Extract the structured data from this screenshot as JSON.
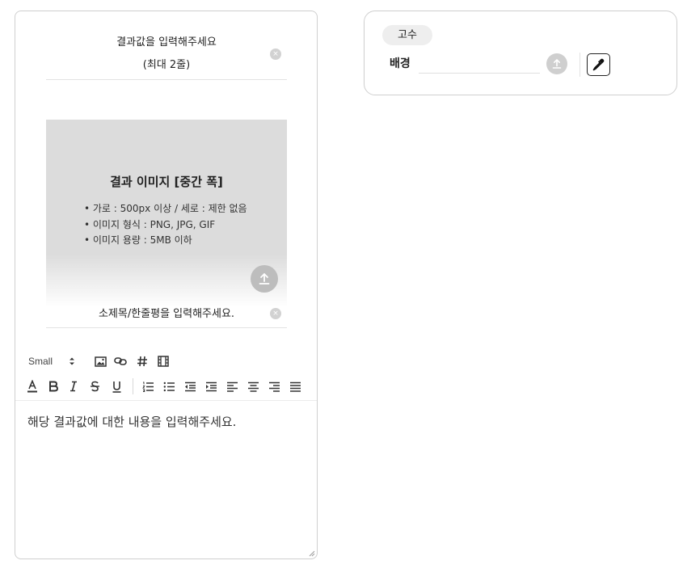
{
  "result_card": {
    "title_placeholder_line1": "결과값을 입력해주세요",
    "title_placeholder_line2": "(최대 2줄)",
    "image": {
      "title": "결과 이미지 [중간 폭]",
      "bullets": [
        "• 가로 : 500px 이상 / 세로 : 제한 없음",
        "• 이미지 형식 : PNG, JPG, GIF",
        "• 이미지 용량 : 5MB 이하"
      ]
    },
    "subtitle_placeholder": "소제목/한줄평을 입력해주세요.",
    "clear_symbol": "×",
    "editor": {
      "font_size": "Small",
      "placeholder": "해당 결과값에 대한 내용을 입력해주세요.",
      "toolbar_row1": [
        "image-icon",
        "link-icon",
        "hashtag-icon",
        "video-icon"
      ],
      "toolbar_row2": [
        "text-color-icon",
        "bold-icon",
        "italic-icon",
        "strikethrough-icon",
        "underline-icon",
        "ordered-list-icon",
        "bullet-list-icon",
        "outdent-icon",
        "indent-icon",
        "align-left-icon",
        "align-center-icon",
        "align-right-icon",
        "align-justify-icon"
      ]
    }
  },
  "level_card": {
    "level": "고수",
    "background_label": "배경",
    "background_value": ""
  },
  "colors": {
    "image_placeholder_bg": "#dcdcdc",
    "upload_button": "#bdbdbd",
    "border": "#cfcfcf"
  }
}
